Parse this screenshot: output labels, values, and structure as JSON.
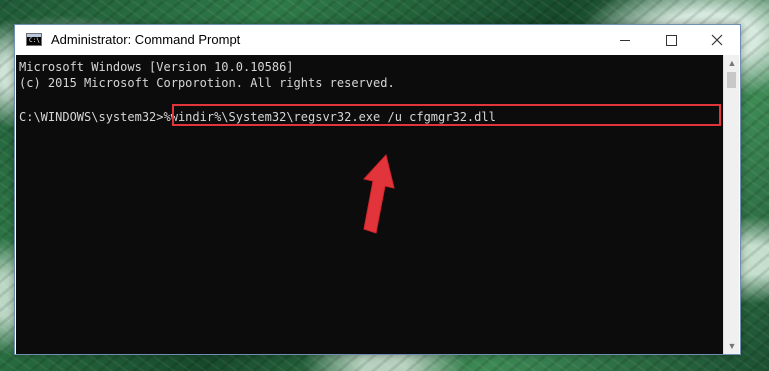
{
  "window": {
    "title": "Administrator: Command Prompt",
    "controls": {
      "minimize": "minimize",
      "maximize": "maximize",
      "close": "close"
    }
  },
  "console": {
    "lines": [
      "Microsoft Windows [Version 10.0.10586]",
      "(c) 2015 Microsoft Corporotion. All rights reserved."
    ],
    "prompt": "C:\\WINDOWS\\system32>",
    "command": "%windir%\\System32\\regsvr32.exe /u cfgmgr32.dll"
  },
  "icons": {
    "app": "command-prompt-icon",
    "minimize": "minimize-icon",
    "maximize": "maximize-icon",
    "close": "close-icon",
    "annotation": "red-arrow-icon"
  },
  "colors": {
    "console_background": "#0c0c0c",
    "console_text": "#d6d6d6",
    "highlight": "#e2353b",
    "window_border": "#6f8fb0"
  }
}
